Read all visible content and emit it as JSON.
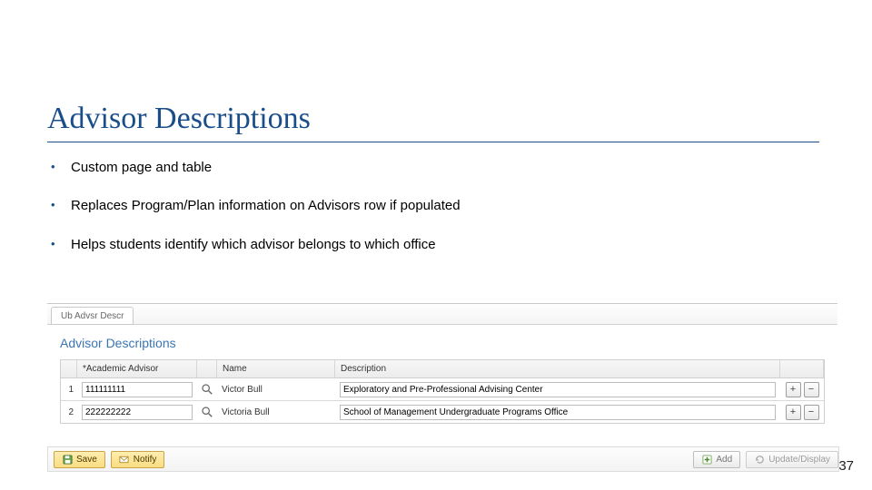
{
  "title": "Advisor Descriptions",
  "bullets": [
    "Custom page and table",
    "Replaces Program/Plan information on Advisors row if populated",
    "Helps students identify which advisor belongs to which office"
  ],
  "app": {
    "tab_label": "Ub Advsr Descr",
    "section_heading": "Advisor Descriptions",
    "columns": {
      "advisor": "*Academic Advisor",
      "name": "Name",
      "description": "Description"
    },
    "rows": [
      {
        "num": "1",
        "advisor_id": "111111111",
        "name": "Victor Bull",
        "description": "Exploratory and Pre-Professional Advising Center"
      },
      {
        "num": "2",
        "advisor_id": "222222222",
        "name": "Victoria Bull",
        "description": "School of Management Undergraduate Programs Office"
      }
    ],
    "row_add_label": "+",
    "row_del_label": "−"
  },
  "actions": {
    "save": "Save",
    "notify": "Notify",
    "add": "Add",
    "update_display": "Update/Display"
  },
  "page_number": "37"
}
